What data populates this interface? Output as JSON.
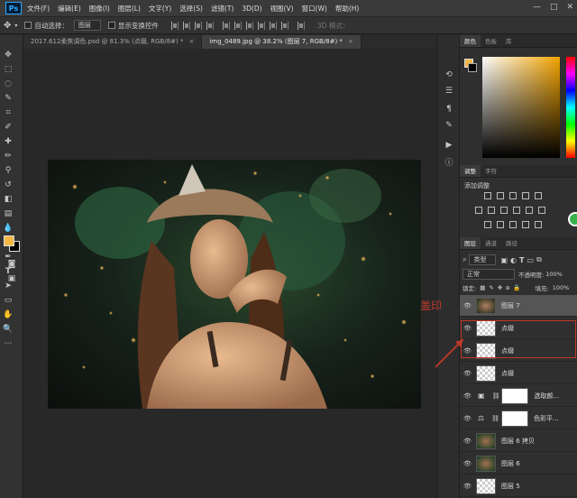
{
  "app": {
    "logo": "Ps"
  },
  "menu": [
    "文件(F)",
    "编辑(E)",
    "图像(I)",
    "图层(L)",
    "文字(Y)",
    "选择(S)",
    "滤镜(T)",
    "3D(D)",
    "视图(V)",
    "窗口(W)",
    "帮助(H)"
  ],
  "window_controls": [
    "—",
    "□",
    "✕"
  ],
  "options": {
    "auto_select_label": "自动选择：",
    "auto_select_value": "图层",
    "show_transform_label": "显示变换控件",
    "mode_3d_label": "3D 模式："
  },
  "tabs": [
    {
      "label": "2017.612柔焦调色.psd @ 81.3% (点缀, RGB/8#) *",
      "active": false
    },
    {
      "label": "img_0489.jpg @ 38.2% (图层 7, RGB/8#) *",
      "active": true
    }
  ],
  "panels": {
    "color_tabs": [
      "颜色",
      "色板",
      "库"
    ],
    "adjust_tabs": [
      "调整",
      "字符"
    ],
    "adjust_title": "添加调整",
    "layers_tabs": [
      "图层",
      "通道",
      "路径"
    ],
    "filter_kind": "类型",
    "blend_mode": "正常",
    "opacity_label": "不透明度:",
    "opacity_value": "100%",
    "lock_label": "锁定:",
    "fill_label": "填充:",
    "fill_value": "100%"
  },
  "layers": [
    {
      "name": "图层 7",
      "thumb": "photo",
      "selected": true
    },
    {
      "name": "点缀",
      "thumb": "checker",
      "selected": false
    },
    {
      "name": "点缀",
      "thumb": "checker",
      "selected": false
    },
    {
      "name": "点缀",
      "thumb": "checker",
      "selected": false
    },
    {
      "name": "选取颜...",
      "thumb": "white",
      "selected": false,
      "adjustment": true
    },
    {
      "name": "色彩平...",
      "thumb": "white",
      "selected": false,
      "adjustment": true
    },
    {
      "name": "图层 6 拷贝",
      "thumb": "photo",
      "selected": false
    },
    {
      "name": "图层 6",
      "thumb": "photo",
      "selected": false
    },
    {
      "name": "图层 5",
      "thumb": "checker",
      "selected": false
    }
  ],
  "annotation": {
    "text": "盖印",
    "color": "#c0392b"
  },
  "colors": {
    "foreground": "#f2b744",
    "background": "#000000",
    "accent": "#31a8ff"
  }
}
